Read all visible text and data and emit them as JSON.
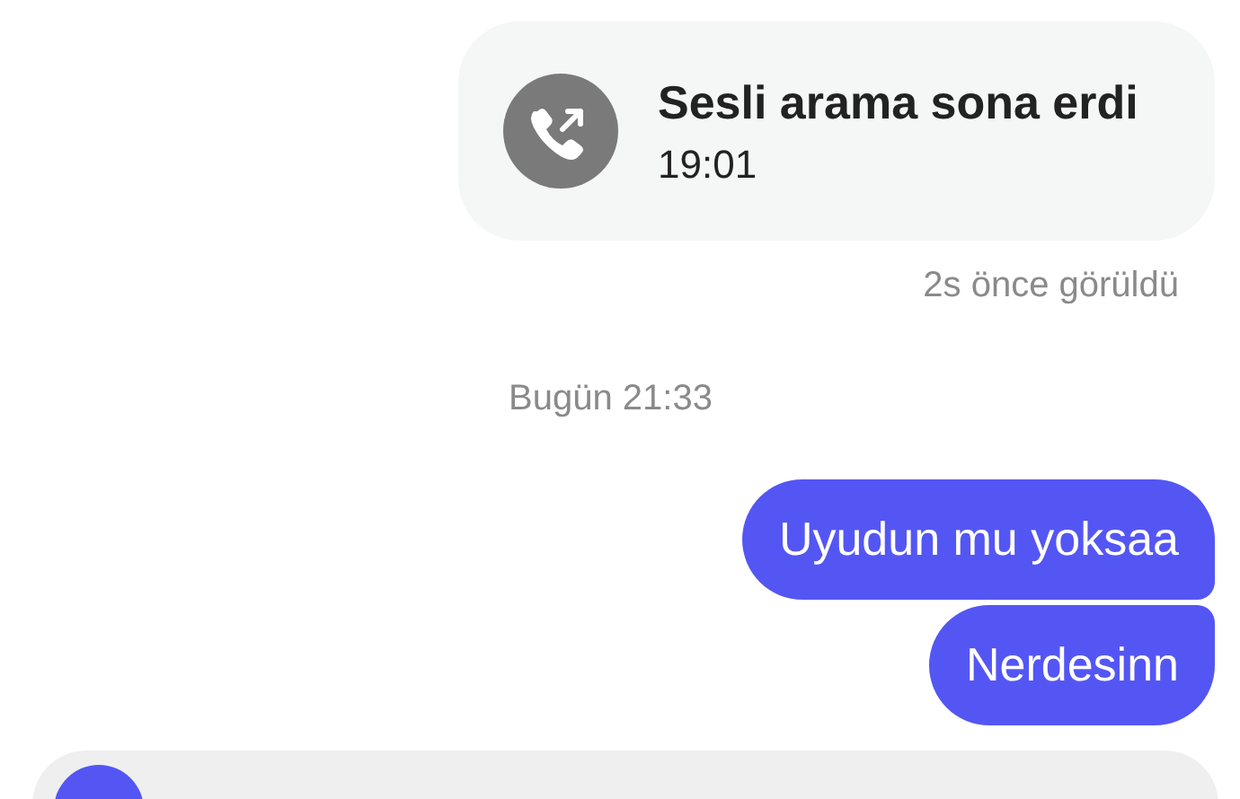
{
  "call_card": {
    "title": "Sesli arama sona erdi",
    "time": "19:01"
  },
  "seen_status": "2s önce görüldü",
  "date_separator": "Bugün 21:33",
  "messages": [
    {
      "text": "Uyudun mu yoksaa"
    },
    {
      "text": "Nerdesinn"
    }
  ],
  "composer": {
    "kind": "bar"
  }
}
